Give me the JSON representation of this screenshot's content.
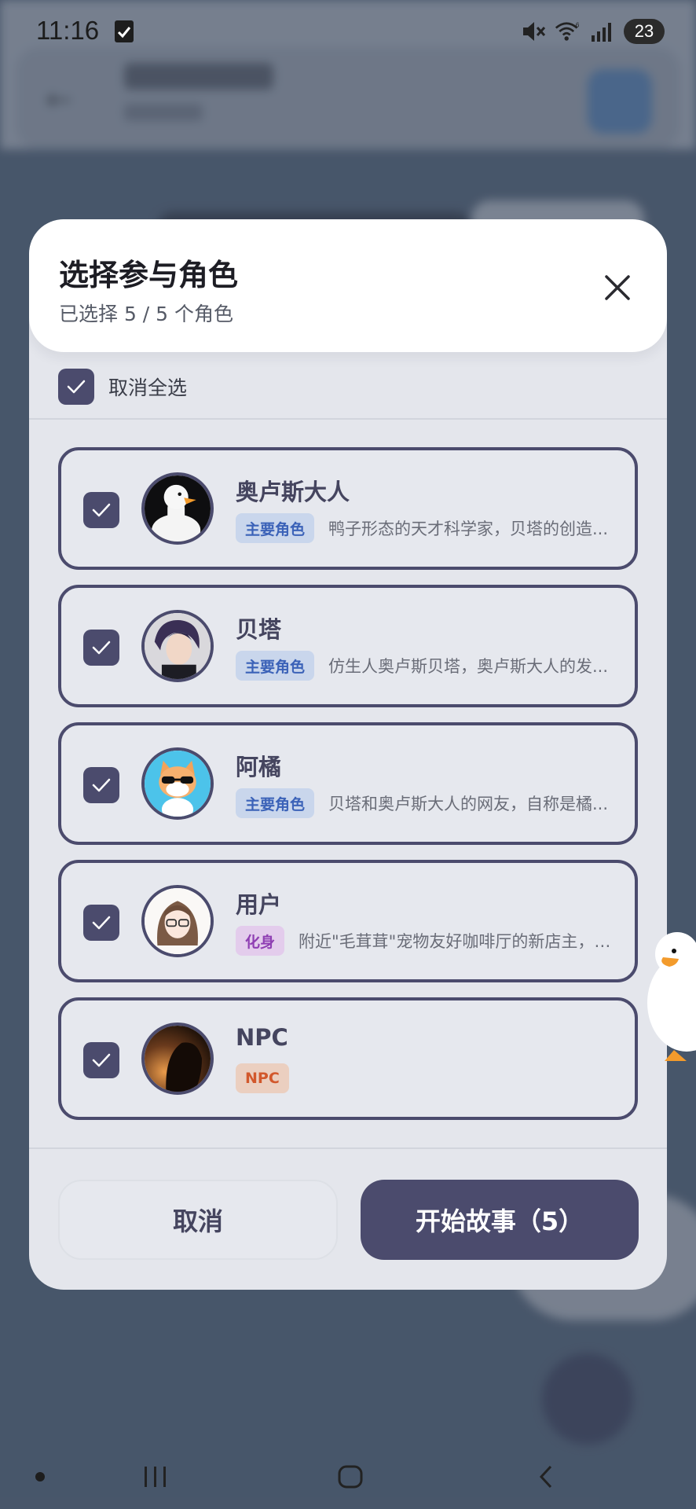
{
  "status_bar": {
    "time": "11:16",
    "battery": "23",
    "icons": [
      "checkbox-notification-icon",
      "mute-icon",
      "wifi-icon",
      "signal-icon",
      "battery-icon"
    ]
  },
  "dialog": {
    "title": "选择参与角色",
    "subtitle": "已选择 5 / 5 个角色",
    "select_all_label": "取消全选",
    "cancel_label": "取消",
    "start_label": "开始故事（5）"
  },
  "characters": [
    {
      "name": "奥卢斯大人",
      "tag": "主要角色",
      "tag_type": "main",
      "description": "鸭子形态的天才科学家，贝塔的创造...",
      "avatar": "duck-avatar",
      "checked": true
    },
    {
      "name": "贝塔",
      "tag": "主要角色",
      "tag_type": "main",
      "description": "仿生人奥卢斯贝塔，奥卢斯大人的发...",
      "avatar": "anime-boy-avatar",
      "checked": true
    },
    {
      "name": "阿橘",
      "tag": "主要角色",
      "tag_type": "main",
      "description": "贝塔和奥卢斯大人的网友，自称是橘...",
      "avatar": "cat-sunglasses-avatar",
      "checked": true
    },
    {
      "name": "用户",
      "tag": "化身",
      "tag_type": "avatar",
      "description": "附近\"毛茸茸\"宠物友好咖啡厅的新店主，刚...",
      "avatar": "anime-girl-glasses-avatar",
      "checked": true
    },
    {
      "name": "NPC",
      "tag": "NPC",
      "tag_type": "npc",
      "description": "",
      "avatar": "silhouette-avatar",
      "checked": true
    }
  ],
  "colors": {
    "accent": "#4b4b6d",
    "tag_main_bg": "#c9d6ec",
    "tag_main_text": "#3b62b8",
    "tag_avatar_bg": "#e3ccec",
    "tag_avatar_text": "#8f3fb3",
    "tag_npc_bg": "#ebcfc0",
    "tag_npc_text": "#d2582c"
  }
}
